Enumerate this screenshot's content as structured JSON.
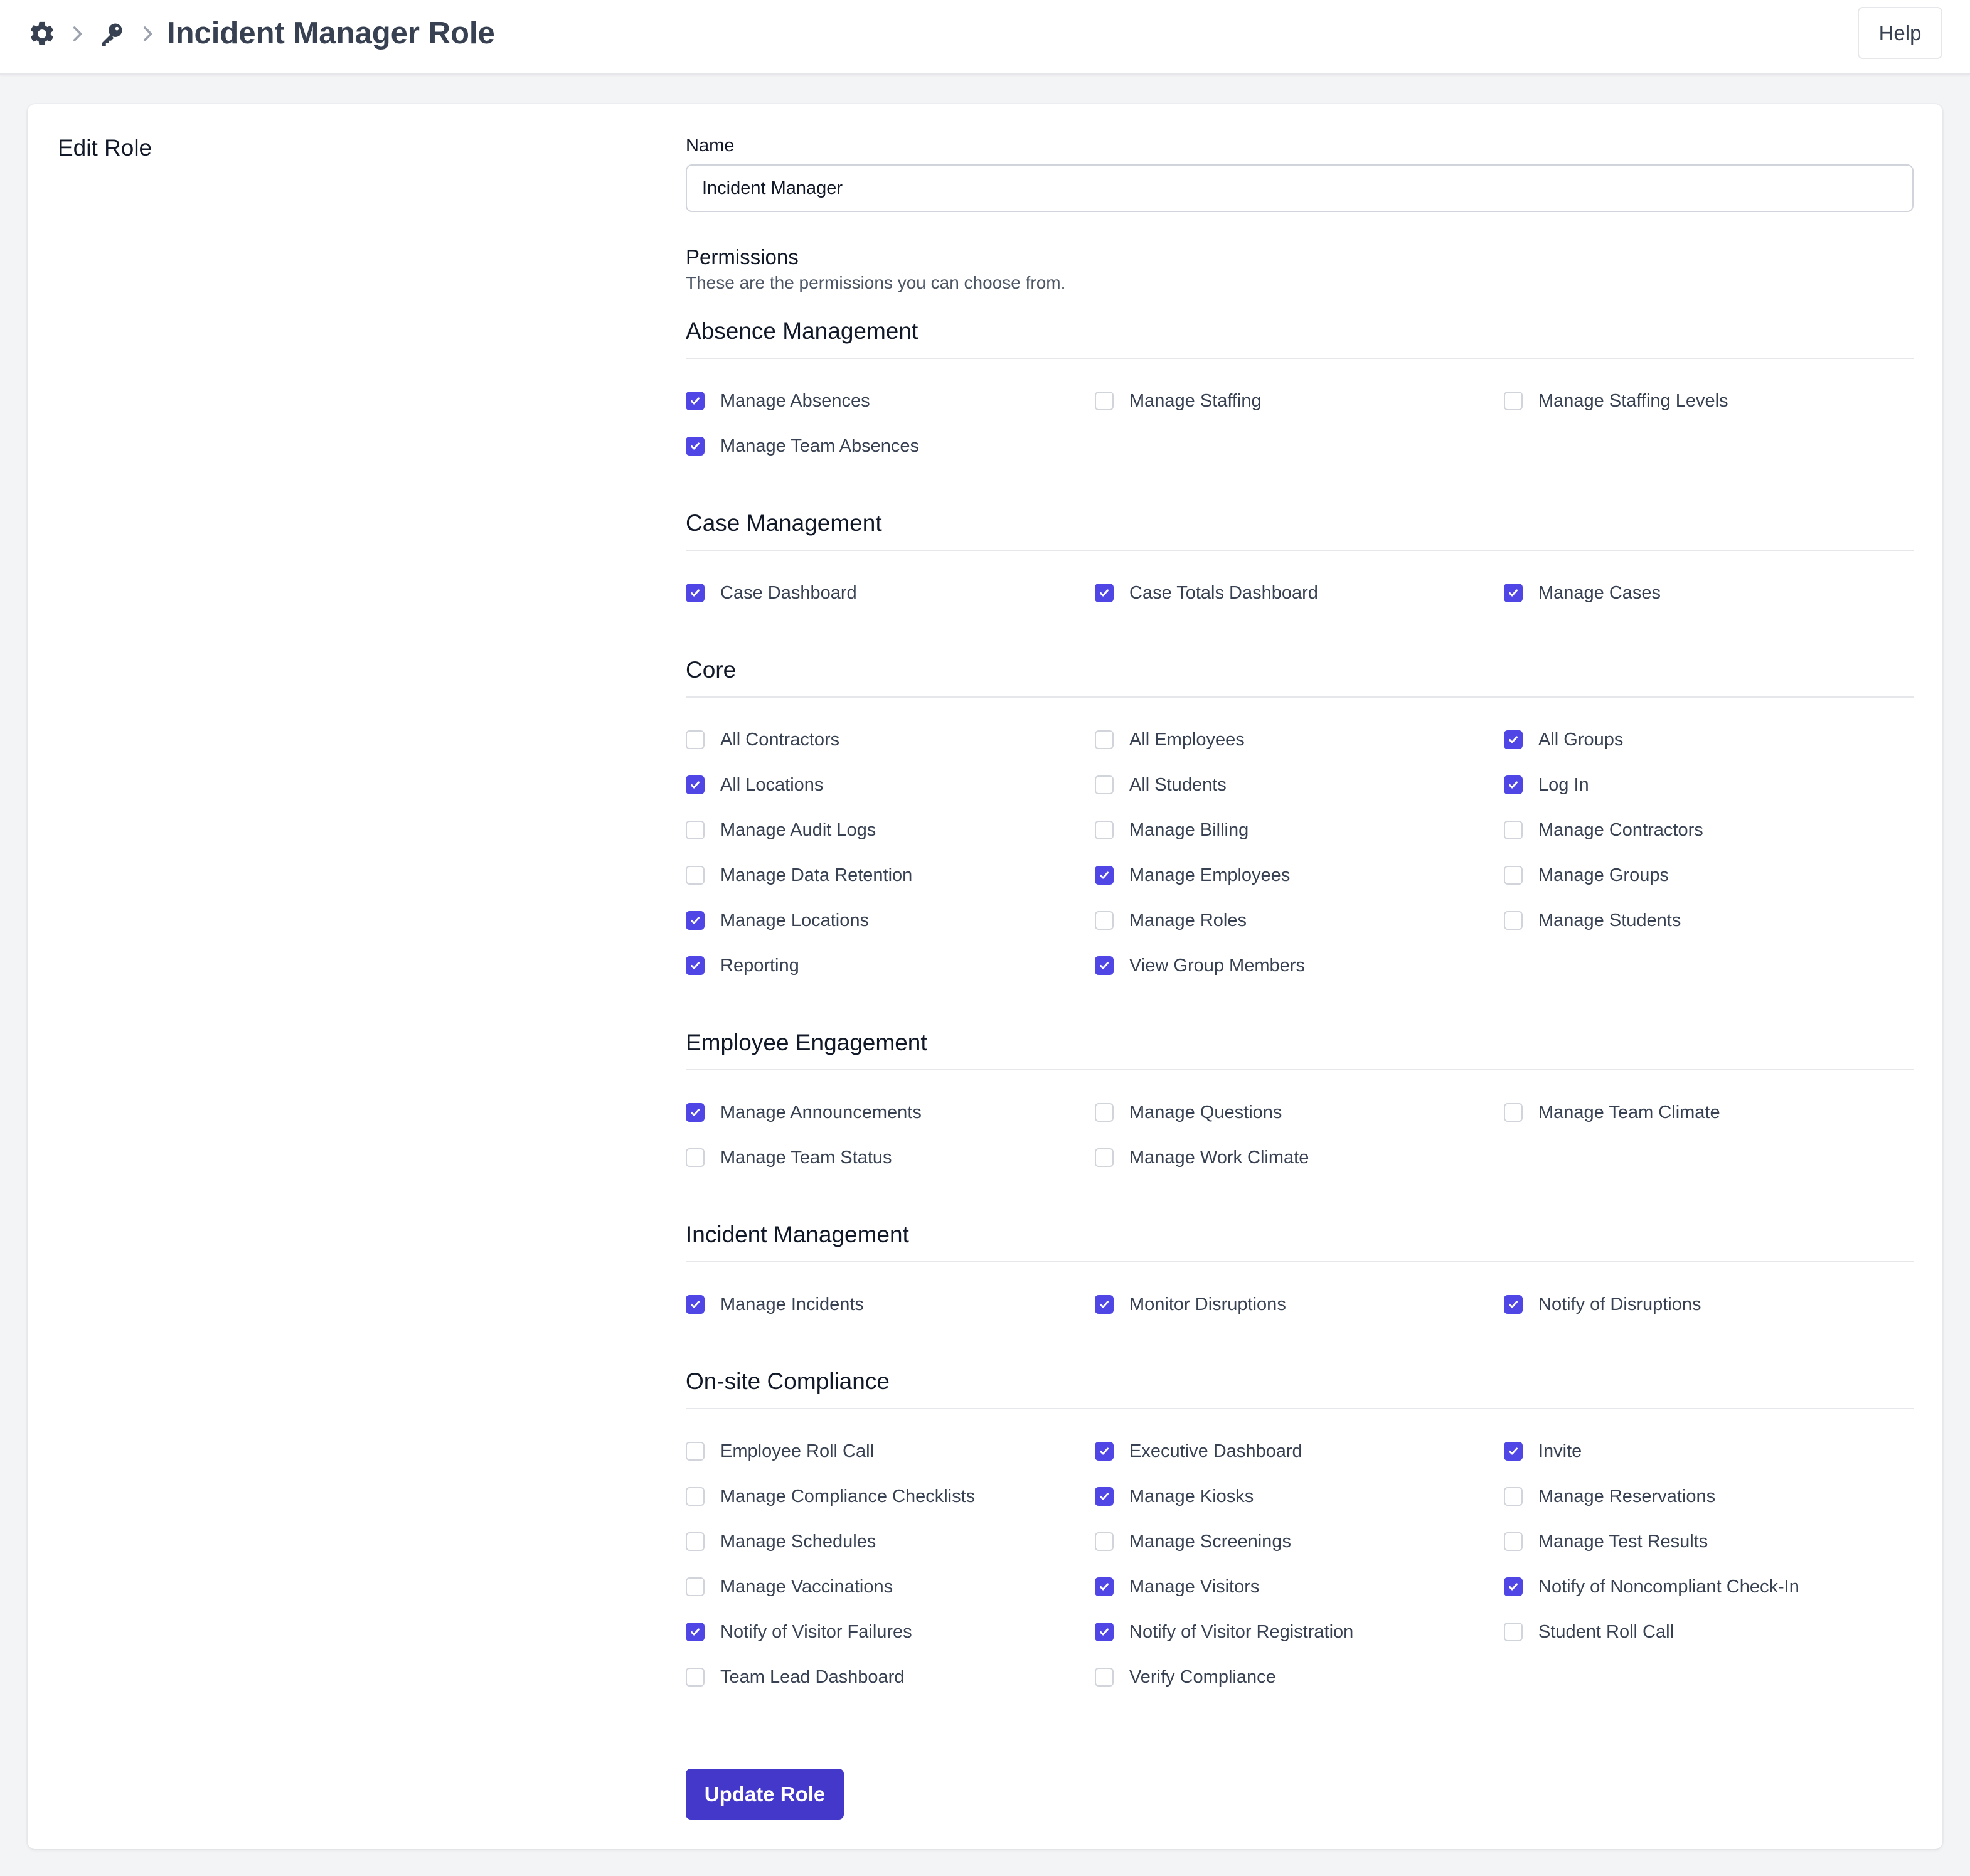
{
  "header": {
    "title": "Incident Manager Role",
    "help_label": "Help",
    "icons": [
      "gear-icon",
      "chevron-right-icon",
      "key-icon",
      "chevron-right-icon"
    ]
  },
  "form": {
    "heading": "Edit Role",
    "name_label": "Name",
    "name_value": "Incident Manager",
    "permissions_title": "Permissions",
    "permissions_subtitle": "These are the permissions you can choose from.",
    "submit_label": "Update Role"
  },
  "colors": {
    "accent": "#4f46e5",
    "button": "#4338ca",
    "border": "#e5e7eb"
  },
  "sections": [
    {
      "name": "Absence Management",
      "items": [
        {
          "label": "Manage Absences",
          "checked": true
        },
        {
          "label": "Manage Staffing",
          "checked": false
        },
        {
          "label": "Manage Staffing Levels",
          "checked": false
        },
        {
          "label": "Manage Team Absences",
          "checked": true
        }
      ]
    },
    {
      "name": "Case Management",
      "items": [
        {
          "label": "Case Dashboard",
          "checked": true
        },
        {
          "label": "Case Totals Dashboard",
          "checked": true
        },
        {
          "label": "Manage Cases",
          "checked": true
        }
      ]
    },
    {
      "name": "Core",
      "items": [
        {
          "label": "All Contractors",
          "checked": false
        },
        {
          "label": "All Employees",
          "checked": false
        },
        {
          "label": "All Groups",
          "checked": true
        },
        {
          "label": "All Locations",
          "checked": true
        },
        {
          "label": "All Students",
          "checked": false
        },
        {
          "label": "Log In",
          "checked": true
        },
        {
          "label": "Manage Audit Logs",
          "checked": false
        },
        {
          "label": "Manage Billing",
          "checked": false
        },
        {
          "label": "Manage Contractors",
          "checked": false
        },
        {
          "label": "Manage Data Retention",
          "checked": false
        },
        {
          "label": "Manage Employees",
          "checked": true
        },
        {
          "label": "Manage Groups",
          "checked": false
        },
        {
          "label": "Manage Locations",
          "checked": true
        },
        {
          "label": "Manage Roles",
          "checked": false
        },
        {
          "label": "Manage Students",
          "checked": false
        },
        {
          "label": "Reporting",
          "checked": true
        },
        {
          "label": "View Group Members",
          "checked": true
        }
      ]
    },
    {
      "name": "Employee Engagement",
      "items": [
        {
          "label": "Manage Announcements",
          "checked": true
        },
        {
          "label": "Manage Questions",
          "checked": false
        },
        {
          "label": "Manage Team Climate",
          "checked": false
        },
        {
          "label": "Manage Team Status",
          "checked": false
        },
        {
          "label": "Manage Work Climate",
          "checked": false
        }
      ]
    },
    {
      "name": "Incident Management",
      "items": [
        {
          "label": "Manage Incidents",
          "checked": true
        },
        {
          "label": "Monitor Disruptions",
          "checked": true
        },
        {
          "label": "Notify of Disruptions",
          "checked": true
        }
      ]
    },
    {
      "name": "On-site Compliance",
      "items": [
        {
          "label": "Employee Roll Call",
          "checked": false
        },
        {
          "label": "Executive Dashboard",
          "checked": true
        },
        {
          "label": "Invite",
          "checked": true
        },
        {
          "label": "Manage Compliance Checklists",
          "checked": false
        },
        {
          "label": "Manage Kiosks",
          "checked": true
        },
        {
          "label": "Manage Reservations",
          "checked": false
        },
        {
          "label": "Manage Schedules",
          "checked": false
        },
        {
          "label": "Manage Screenings",
          "checked": false
        },
        {
          "label": "Manage Test Results",
          "checked": false
        },
        {
          "label": "Manage Vaccinations",
          "checked": false
        },
        {
          "label": "Manage Visitors",
          "checked": true
        },
        {
          "label": "Notify of Noncompliant Check-In",
          "checked": true
        },
        {
          "label": "Notify of Visitor Failures",
          "checked": true
        },
        {
          "label": "Notify of Visitor Registration",
          "checked": true
        },
        {
          "label": "Student Roll Call",
          "checked": false
        },
        {
          "label": "Team Lead Dashboard",
          "checked": false
        },
        {
          "label": "Verify Compliance",
          "checked": false
        }
      ]
    }
  ]
}
